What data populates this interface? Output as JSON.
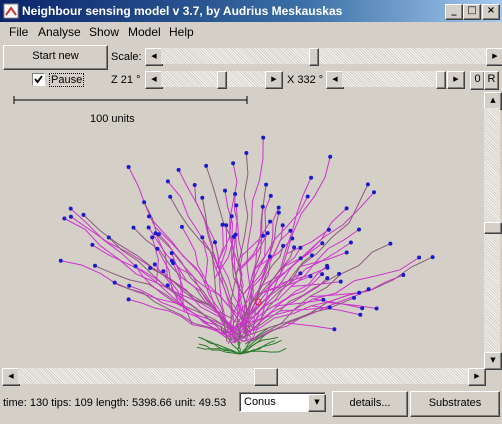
{
  "window": {
    "title": "Neighbour sensing model v 3.7, by Audrius Meskauskas"
  },
  "menu": [
    "File",
    "Analyse",
    "Show",
    "Model",
    "Help"
  ],
  "toolbar": {
    "start_new": "Start new",
    "scale_label": "Scale:",
    "pause_label": "Pause",
    "pause_checked": true,
    "z_label": "Z 21 °",
    "x_label": "X 332 °",
    "btn_0": "0",
    "btn_r": "R"
  },
  "canvas": {
    "scale_bar_label": "100 units"
  },
  "status": {
    "text": "time: 130 tips: 109 length: 5398.66 unit: 49.53",
    "model_select": "Conus",
    "details_button": "details...",
    "substrates_button": "Substrates"
  },
  "colors": {
    "hyphae_young": "#cc33cc",
    "hyphae_old": "#8a5a7a",
    "hyphae_base": "#2a7a2a",
    "tips": "#1a1acc"
  }
}
